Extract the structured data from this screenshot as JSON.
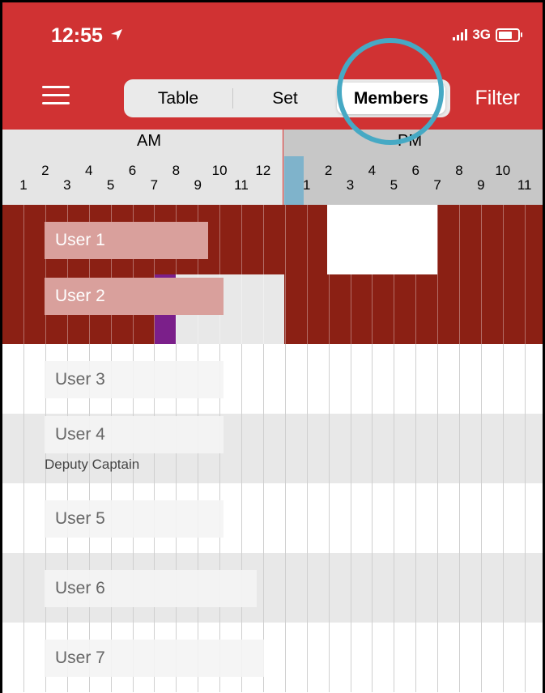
{
  "status_bar": {
    "time": "12:55",
    "network": "3G"
  },
  "nav": {
    "tabs": [
      {
        "label": "Table",
        "selected": false
      },
      {
        "label": "Set",
        "selected": false
      },
      {
        "label": "Members",
        "selected": true
      }
    ],
    "filter_label": "Filter"
  },
  "timeline": {
    "am_label": "AM",
    "pm_label": "PM",
    "am_ticks": [
      "1",
      "2",
      "3",
      "4",
      "5",
      "6",
      "7",
      "8",
      "9",
      "10",
      "11",
      "12"
    ],
    "pm_ticks": [
      "1",
      "2",
      "3",
      "4",
      "5",
      "6",
      "7",
      "8",
      "9",
      "10",
      "11"
    ]
  },
  "members": [
    {
      "name": "User 1",
      "subtitle": ""
    },
    {
      "name": "User 2",
      "subtitle": ""
    },
    {
      "name": "User 3",
      "subtitle": ""
    },
    {
      "name": "User 4",
      "subtitle": "Deputy Captain"
    },
    {
      "name": "User 5",
      "subtitle": ""
    },
    {
      "name": "User 6",
      "subtitle": ""
    },
    {
      "name": "User 7",
      "subtitle": ""
    }
  ],
  "colors": {
    "header": "#d03233",
    "busy": "#8b2014",
    "tentative": "#7b1f8a",
    "now": "#7fb3cb",
    "highlight_circle": "#46a9c4"
  },
  "icons": [
    "location-arrow-icon",
    "signal-icon",
    "battery-icon",
    "hamburger-menu-icon"
  ]
}
